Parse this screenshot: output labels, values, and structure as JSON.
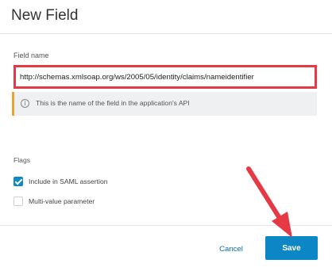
{
  "dialog": {
    "title": "New Field"
  },
  "field_name": {
    "label": "Field name",
    "value": "http://schemas.xmlsoap.org/ws/2005/05/identity/claims/nameidentifier",
    "hint": "This is the name of the field in the application's API",
    "hint_icon": "info-icon"
  },
  "flags": {
    "label": "Flags",
    "items": [
      {
        "label": "Include in SAML assertion",
        "checked": true
      },
      {
        "label": "Multi-value parameter",
        "checked": false
      }
    ]
  },
  "footer": {
    "cancel_label": "Cancel",
    "save_label": "Save"
  },
  "colors": {
    "accent": "#0c86c4",
    "annotation_red": "#e63946",
    "hint_border": "#f0a030"
  }
}
